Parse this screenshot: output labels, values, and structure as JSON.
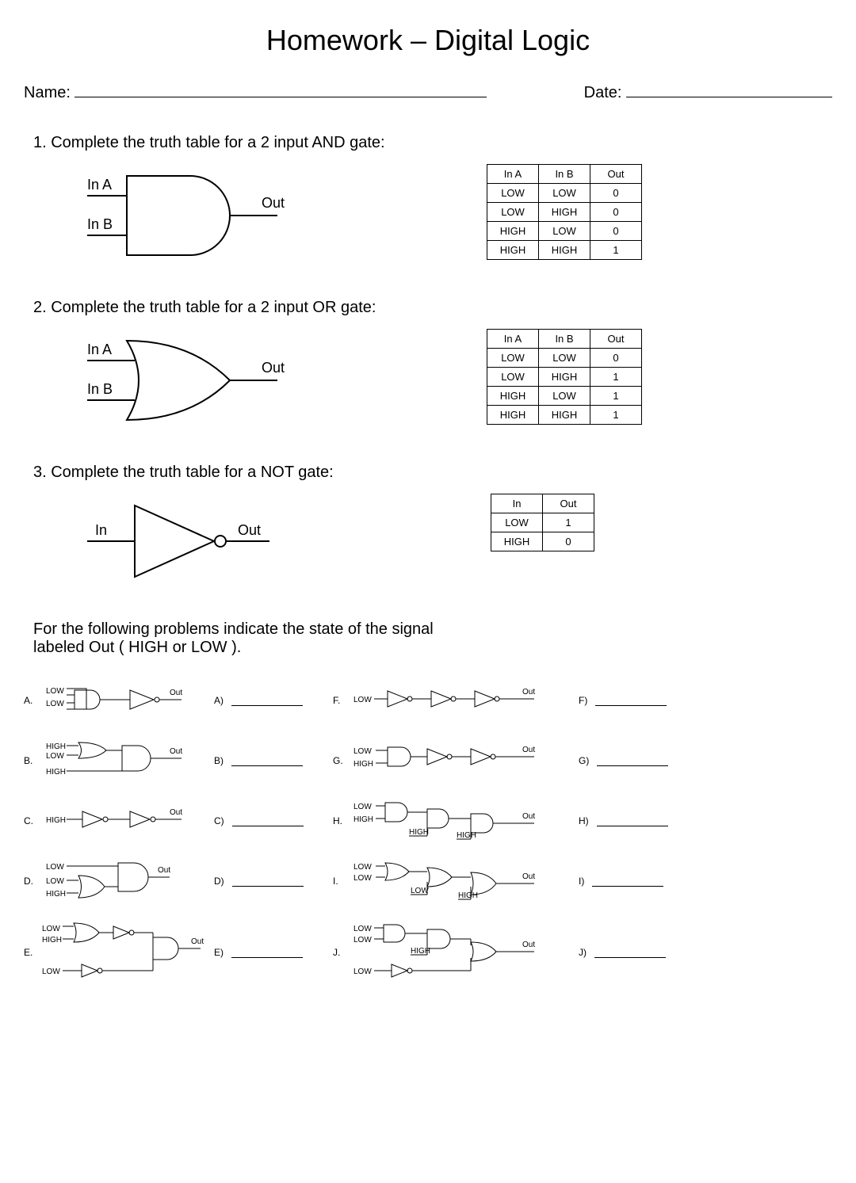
{
  "title": "Homework – Digital Logic",
  "nameLabel": "Name:",
  "dateLabel": "Date:",
  "q1": {
    "head": "1. Complete the truth table for a 2 input AND gate:",
    "inA": "In A",
    "inB": "In B",
    "out": "Out",
    "th": [
      "In A",
      "In B",
      "Out"
    ],
    "rows": [
      [
        "LOW",
        "LOW",
        "0"
      ],
      [
        "LOW",
        "HIGH",
        "0"
      ],
      [
        "HIGH",
        "LOW",
        "0"
      ],
      [
        "HIGH",
        "HIGH",
        "1"
      ]
    ]
  },
  "q2": {
    "head": "2. Complete the truth table for a 2 input OR gate:",
    "inA": "In A",
    "inB": "In B",
    "out": "Out",
    "th": [
      "In A",
      "In B",
      "Out"
    ],
    "rows": [
      [
        "LOW",
        "LOW",
        "0"
      ],
      [
        "LOW",
        "HIGH",
        "1"
      ],
      [
        "HIGH",
        "LOW",
        "1"
      ],
      [
        "HIGH",
        "HIGH",
        "1"
      ]
    ]
  },
  "q3": {
    "head": "3. Complete the truth table for a NOT gate:",
    "in": "In",
    "out": "Out",
    "th": [
      "In",
      "Out"
    ],
    "rows": [
      [
        "LOW",
        "1"
      ],
      [
        "HIGH",
        "0"
      ]
    ]
  },
  "instr": "For the following problems indicate the state of the signal labeled Out ( HIGH or LOW ).",
  "labelsLeft": [
    "A.",
    "B.",
    "C.",
    "D.",
    "E."
  ],
  "labelsRight": [
    "F.",
    "G.",
    "H.",
    "I.",
    "J."
  ],
  "ansLeft": [
    "A)",
    "B)",
    "C)",
    "D)",
    "E)"
  ],
  "ansRight": [
    "F)",
    "G)",
    "H)",
    "I)",
    "J)"
  ],
  "sig": {
    "LOW": "LOW",
    "HIGH": "HIGH",
    "Out": "Out"
  }
}
